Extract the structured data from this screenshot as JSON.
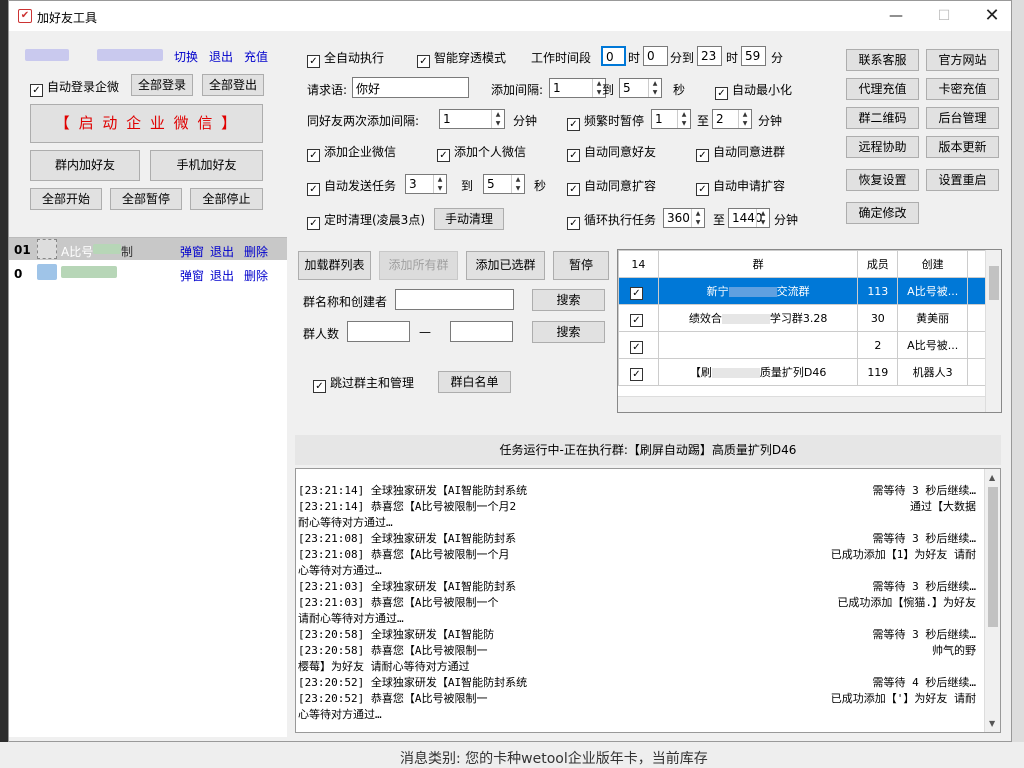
{
  "window": {
    "title": "加好友工具"
  },
  "account": {
    "links": [
      "切换",
      "退出",
      "充值"
    ]
  },
  "left": {
    "auto_login": "自动登录企微",
    "login_all": "全部登录",
    "logout_all": "全部登出",
    "start_wecom": "【 启 动 企 业 微 信 】",
    "group_add": "群内加好友",
    "phone_add": "手机加好友",
    "start_all": "全部开始",
    "pause_all": "全部暂停",
    "stop_all": "全部停止",
    "rows": [
      {
        "idx": "01",
        "name": "A比号",
        "tail": "制",
        "a1": "弹窗",
        "a2": "退出",
        "a3": "删除"
      },
      {
        "idx": "0",
        "name": "",
        "tail": "",
        "a1": "弹窗",
        "a2": "退出",
        "a3": "删除"
      }
    ]
  },
  "settings": {
    "auto_exec": "全自动执行",
    "smart_mode": "智能穿透模式",
    "work_time": "工作时间段",
    "t_h1": "0",
    "t_u1": "时",
    "t_m1": "0",
    "t_u2": "分到",
    "t_h2": "23",
    "t_u3": "时",
    "t_m2": "59",
    "t_u4": "分",
    "request_label": "请求语:",
    "request_value": "你好",
    "add_interval": "添加间隔:",
    "iv_from": "1",
    "to": "到",
    "iv_to": "5",
    "sec": "秒",
    "auto_min": "自动最小化",
    "same_friend": "同好友两次添加间隔:",
    "same_val": "1",
    "minute": "分钟",
    "freq_pause": "频繁时暂停",
    "fp_from": "1",
    "zhi": "至",
    "fp_to": "2",
    "add_wecom": "添加企业微信",
    "add_personal": "添加个人微信",
    "auto_accept_friend": "自动同意好友",
    "auto_accept_group": "自动同意进群",
    "auto_send": "自动发送任务",
    "as_from": "3",
    "as_to": "5",
    "auto_agree_expand": "自动同意扩容",
    "auto_apply_expand": "自动申请扩容",
    "timed_clear": "定时清理(凌晨3点)",
    "manual_clear": "手动清理",
    "loop_task": "循环执行任务",
    "loop_from": "360",
    "loop_to": "1440"
  },
  "right_buttons": [
    "联系客服",
    "官方网站",
    "代理充值",
    "卡密充值",
    "群二维码",
    "后台管理",
    "远程协助",
    "版本更新",
    "恢复设置",
    "设置重启",
    "确定修改"
  ],
  "group": {
    "load": "加载群列表",
    "add_all": "添加所有群",
    "add_selected": "添加已选群",
    "pause": "暂停",
    "name_label": "群名称和创建者",
    "search": "搜索",
    "count_label": "群人数",
    "dash": "—",
    "skip_admin": "跳过群主和管理",
    "whitelist": "群白名单"
  },
  "table": {
    "headers": [
      "14",
      "群",
      "成员",
      "创建"
    ],
    "rows": [
      {
        "name": "新宁",
        "name2": "交流群",
        "members": "113",
        "creator": "A比号被...",
        "sel": true
      },
      {
        "name": "绩效合",
        "name2": "学习群3.28",
        "members": "30",
        "creator": "黄美丽",
        "sel": false
      },
      {
        "name": "",
        "name2": "",
        "members": "2",
        "creator": "A比号被...",
        "sel": false
      },
      {
        "name": "【刷",
        "name2": "质量扩列D46",
        "members": "119",
        "creator": "机器人3",
        "sel": false
      }
    ]
  },
  "status": "任务运行中-正在执行群:【刷屏自动踢】高质量扩列D46",
  "log": [
    "[23:21:14] 全球独家研发【AI智能防封系统",
    "[23:21:14] 恭喜您【A比号被限制一个月2",
    "耐心等待对方通过…",
    "[23:21:08] 全球独家研发【AI智能防封系",
    "[23:21:08] 恭喜您【A比号被限制一个月",
    "心等待对方通过…",
    "[23:21:03] 全球独家研发【AI智能防封系",
    "[23:21:03] 恭喜您【A比号被限制一个",
    "请耐心等待对方通过…",
    "[23:20:58] 全球独家研发【AI智能防",
    "[23:20:58] 恭喜您【A比号被限制一",
    "樱莓】为好友 请耐心等待对方通过",
    "[23:20:52] 全球独家研发【AI智能防封系统",
    "[23:20:52] 恭喜您【A比号被限制一",
    "心等待对方通过…"
  ],
  "log_right": [
    "需等待 3 秒后继续…",
    "通过【大数据",
    "",
    "需等待 3 秒后继续…",
    "已成功添加【1】为好友 请耐",
    "",
    "需等待 3 秒后继续…",
    "已成功添加【惋猫.】为好友",
    "",
    "需等待 3 秒后继续…",
    "帅气的野",
    "",
    "需等待 4 秒后继续…",
    "已成功添加【'】为好友 请耐",
    ""
  ],
  "desktop": {
    "bottom_text": "消息类别:    您的卡种wetool企业版年卡，当前库存"
  }
}
